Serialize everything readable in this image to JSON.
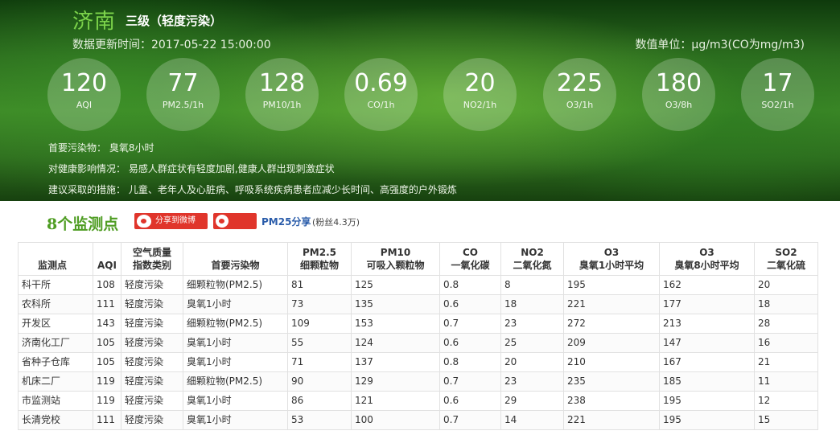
{
  "header": {
    "city": "济南",
    "level": "三级（轻度污染）",
    "update_time": "数据更新时间：2017-05-22 15:00:00",
    "unit": "数值单位：μg/m3(CO为mg/m3)",
    "metrics": [
      {
        "value": "120",
        "label": "AQI"
      },
      {
        "value": "77",
        "label": "PM2.5/1h"
      },
      {
        "value": "128",
        "label": "PM10/1h"
      },
      {
        "value": "0.69",
        "label": "CO/1h"
      },
      {
        "value": "20",
        "label": "NO2/1h"
      },
      {
        "value": "225",
        "label": "O3/1h"
      },
      {
        "value": "180",
        "label": "O3/8h"
      },
      {
        "value": "17",
        "label": "SO2/1h"
      }
    ],
    "primary_pollutant": "首要污染物： 臭氧8小时",
    "health_effect": "对健康影响情况： 易感人群症状有轻度加剧,健康人群出现刺激症状",
    "advice": "建议采取的措施： 儿童、老年人及心脏病、呼吸系统疾病患者应减少长时间、高强度的户外锻炼"
  },
  "stations_bar": {
    "title": "8个监测点",
    "weibo_share": "分享到微博",
    "pm25_share": "PM25分享",
    "fans": "(粉丝4.3万)"
  },
  "table": {
    "headers": [
      {
        "l1": "",
        "l2": "监测点"
      },
      {
        "l1": "",
        "l2": "AQI"
      },
      {
        "l1": "空气质量",
        "l2": "指数类别"
      },
      {
        "l1": "",
        "l2": "首要污染物"
      },
      {
        "l1": "PM2.5",
        "l2": "细颗粒物"
      },
      {
        "l1": "PM10",
        "l2": "可吸入颗粒物"
      },
      {
        "l1": "CO",
        "l2": "一氧化碳"
      },
      {
        "l1": "NO2",
        "l2": "二氧化氮"
      },
      {
        "l1": "O3",
        "l2": "臭氧1小时平均"
      },
      {
        "l1": "O3",
        "l2": "臭氧8小时平均"
      },
      {
        "l1": "SO2",
        "l2": "二氧化硫"
      }
    ],
    "rows": [
      [
        "科干所",
        "108",
        "轻度污染",
        "细颗粒物(PM2.5)",
        "81",
        "125",
        "0.8",
        "8",
        "195",
        "162",
        "20"
      ],
      [
        "农科所",
        "111",
        "轻度污染",
        "臭氧1小时",
        "73",
        "135",
        "0.6",
        "18",
        "221",
        "177",
        "18"
      ],
      [
        "开发区",
        "143",
        "轻度污染",
        "细颗粒物(PM2.5)",
        "109",
        "153",
        "0.7",
        "23",
        "272",
        "213",
        "28"
      ],
      [
        "济南化工厂",
        "105",
        "轻度污染",
        "臭氧1小时",
        "55",
        "124",
        "0.6",
        "25",
        "209",
        "147",
        "16"
      ],
      [
        "省种子仓库",
        "105",
        "轻度污染",
        "臭氧1小时",
        "71",
        "137",
        "0.8",
        "20",
        "210",
        "167",
        "21"
      ],
      [
        "机床二厂",
        "119",
        "轻度污染",
        "细颗粒物(PM2.5)",
        "90",
        "129",
        "0.7",
        "23",
        "235",
        "185",
        "11"
      ],
      [
        "市监测站",
        "119",
        "轻度污染",
        "臭氧1小时",
        "86",
        "121",
        "0.6",
        "29",
        "238",
        "195",
        "12"
      ],
      [
        "长清党校",
        "111",
        "轻度污染",
        "臭氧1小时",
        "53",
        "100",
        "0.7",
        "14",
        "221",
        "195",
        "15"
      ]
    ]
  }
}
